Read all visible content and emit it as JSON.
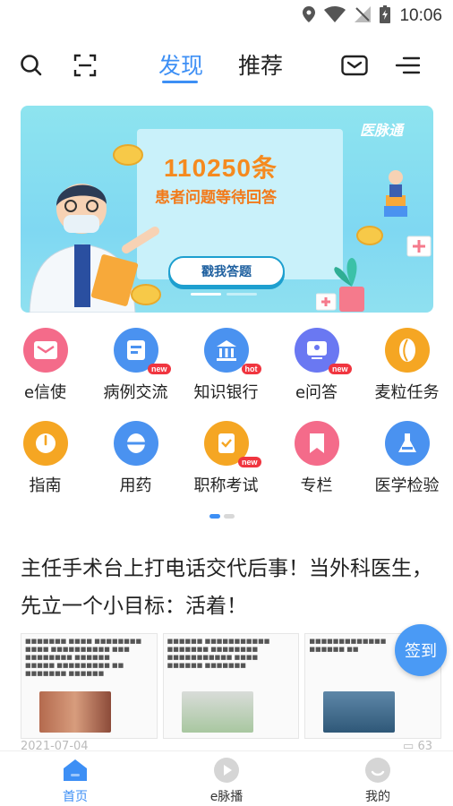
{
  "status_bar": {
    "time": "10:06"
  },
  "top_nav": {
    "tabs": [
      {
        "label": "发现",
        "active": true
      },
      {
        "label": "推荐",
        "active": false
      }
    ],
    "icons": [
      "search-icon",
      "scan-icon",
      "mail-icon",
      "menu-icon"
    ]
  },
  "banner": {
    "count": "110250条",
    "subtitle": "患者问题等待回答",
    "cta": "戳我答题",
    "brand": "医脉通"
  },
  "grid": {
    "items": [
      {
        "label": "e信使",
        "icon": "envelope-icon",
        "color": "#f46b8a",
        "badge": ""
      },
      {
        "label": "病例交流",
        "icon": "case-icon",
        "color": "#4a92f0",
        "badge": "new"
      },
      {
        "label": "知识银行",
        "icon": "bank-icon",
        "color": "#4a92f0",
        "badge": "hot"
      },
      {
        "label": "e问答",
        "icon": "qa-icon",
        "color": "#6a78f2",
        "badge": "new"
      },
      {
        "label": "麦粒任务",
        "icon": "grain-icon",
        "color": "#f5a623",
        "badge": ""
      },
      {
        "label": "指南",
        "icon": "compass-icon",
        "color": "#f5a623",
        "badge": ""
      },
      {
        "label": "用药",
        "icon": "pill-icon",
        "color": "#4a92f0",
        "badge": ""
      },
      {
        "label": "职称考试",
        "icon": "exam-icon",
        "color": "#f5a623",
        "badge": "new"
      },
      {
        "label": "专栏",
        "icon": "bookmark-icon",
        "color": "#f46b8a",
        "badge": ""
      },
      {
        "label": "医学检验",
        "icon": "flask-icon",
        "color": "#4a92f0",
        "badge": ""
      }
    ]
  },
  "article": {
    "title": "主任手术台上打电话交代后事！当外科医生，先立一个小目标：活着！",
    "date": "2021-07-04",
    "comments": "63"
  },
  "checkin": {
    "label": "签到"
  },
  "bottom_nav": {
    "items": [
      {
        "label": "首页",
        "active": true
      },
      {
        "label": "e脉播",
        "active": false
      },
      {
        "label": "我的",
        "active": false
      }
    ]
  },
  "colors": {
    "accent": "#3d8ff5",
    "checkin": "#4a9af5"
  }
}
